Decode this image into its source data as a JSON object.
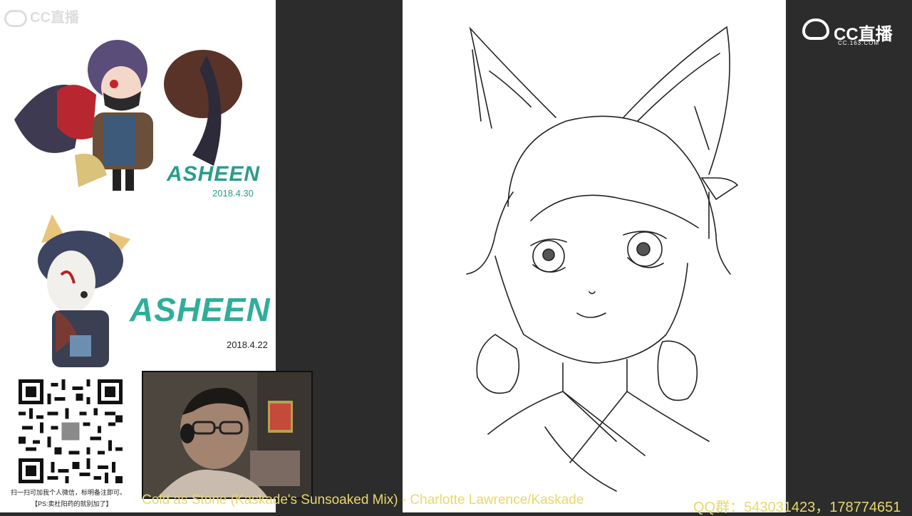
{
  "watermark_tl": "CC直播",
  "poster1": {
    "title": "ASHEEN",
    "date": "2018.4.30"
  },
  "poster2": {
    "title": "ASHEEN",
    "date": "2018.4.22"
  },
  "qr": {
    "caption1": "扫一扫可加我个人微信，标明备注即可。",
    "caption2": "【PS:卖杜阳药的就别加了】"
  },
  "song": "Cold as Stone (Kaskade's Sunsoaked Mix) - Charlotte Lawrence/Kaskade",
  "qq_group": "QQ群：543031423，178774651",
  "cc_logo": {
    "name": "CC直播",
    "domain": "CC.163.COM"
  },
  "colors": {
    "accent": "#2a9d8a",
    "overlay_text": "#e8d86a",
    "bg_dark": "#2c2c2c"
  }
}
